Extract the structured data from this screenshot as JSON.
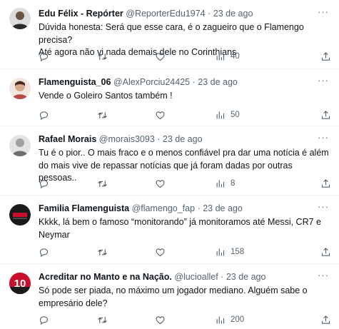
{
  "tweets": [
    {
      "name": "Edu Félix - Repórter",
      "handle": "@ReporterEdu1974",
      "separator": "·",
      "date": "23 de ago",
      "lines": [
        "Dúvida honesta: Será que esse cara, é o zagueiro que o Flamengo precisa?",
        "Até agora não vi nada demais dele no Corinthians"
      ],
      "views": "40",
      "avatar_color": "#2b2b2b"
    },
    {
      "name": "Flamenguista_06",
      "handle": "@AlexPorciu24425",
      "separator": "·",
      "date": "23 de ago",
      "lines": [
        "Vende o Goleiro Santos também !"
      ],
      "views": "50",
      "avatar_color": "#b54a4a"
    },
    {
      "name": "Rafael Morais",
      "handle": "@morais3093",
      "separator": "·",
      "date": "23 de ago",
      "lines": [
        "Tu é o pior.. O mais fraco e o menos confiável pra dar uma notícia é além",
        "do mais vive de repassar notícias que já foram dadas por outras pessoas.."
      ],
      "views": "8",
      "avatar_color": "#8a8a8a"
    },
    {
      "name": "Familia Flamenguista",
      "handle": "@flamengo_fap",
      "separator": "·",
      "date": "23 de ago",
      "lines": [
        "Kkkk, lá bem o famoso “monitorando” já monitoramos até Messi, CR7 e",
        "Neymar"
      ],
      "views": "158",
      "avatar_color": "#1a1a1a"
    },
    {
      "name": "Acreditar no Manto e na Nação.",
      "handle": "@lucioallef",
      "separator": "·",
      "date": "23 de ago",
      "lines": [
        "Só pode ser piada, no máximo um jogador mediano. Alguém sabe o",
        "empresário dele?"
      ],
      "views": "200",
      "avatar_color": "#c8102e",
      "avatar_text": "10"
    }
  ],
  "more_label": "···"
}
